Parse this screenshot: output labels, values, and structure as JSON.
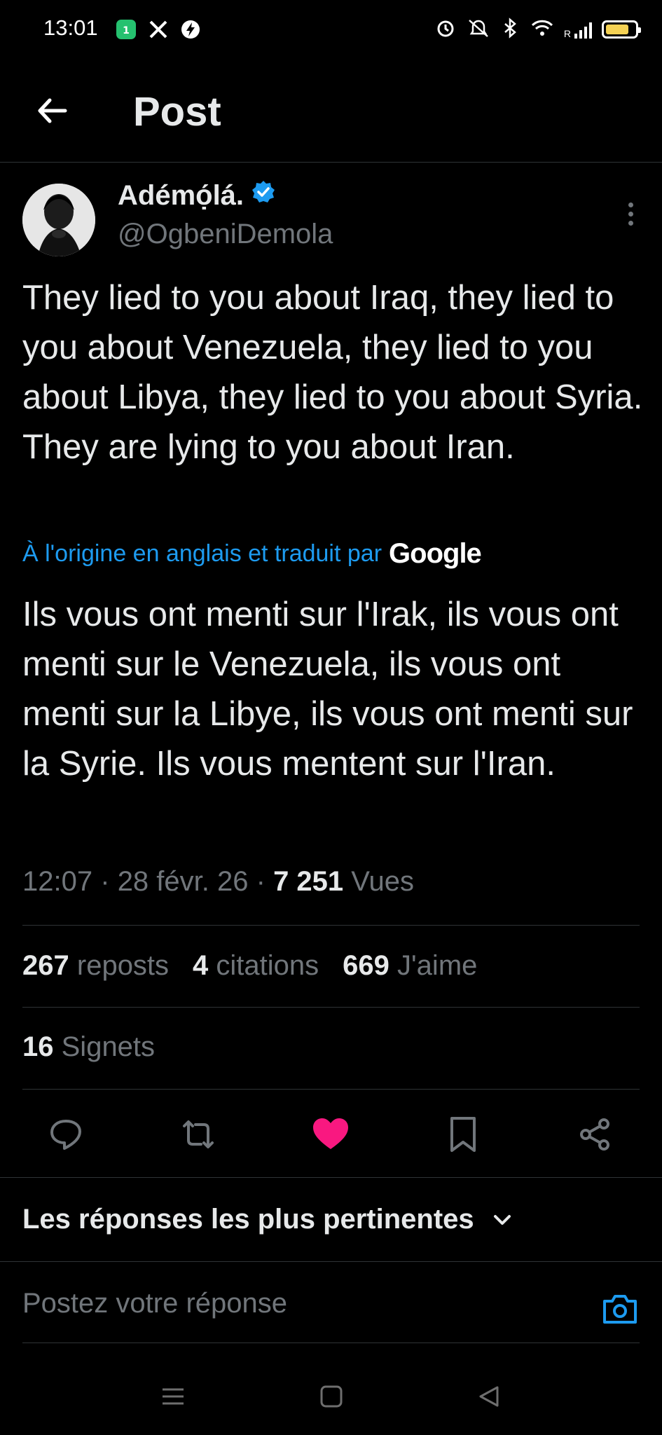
{
  "status_bar": {
    "time": "13:01",
    "icons": [
      "app-badge-icon",
      "x-logo-icon",
      "bolt-icon",
      "alarm-icon",
      "mute-icon",
      "bluetooth-icon",
      "wifi-icon",
      "signal-icon",
      "battery-icon"
    ],
    "signal_label": "R",
    "battery_level": 0.8
  },
  "header": {
    "title": "Post",
    "back_icon": "arrow-left-icon"
  },
  "post": {
    "author_name": "Adémọ́lá.",
    "verified": true,
    "handle": "@OgbeniDemola",
    "text": "They lied to you about Iraq, they lied to you about Venezuela, they lied to you about Libya, they lied to you about Syria. They are lying to you about Iran.",
    "translation_label": "À l'origine en anglais et traduit par",
    "translation_provider": "Google",
    "translated_text": "Ils vous ont menti sur l'Irak, ils vous ont menti sur le Venezuela, ils vous ont menti sur la Libye, ils vous ont menti sur la Syrie. Ils vous mentent sur l'Iran.",
    "time": "12:07",
    "date": "28 févr. 26",
    "views_count": "7 251",
    "views_label": "Vues"
  },
  "stats": {
    "reposts_count": "267",
    "reposts_label": "reposts",
    "quotes_count": "4",
    "quotes_label": "citations",
    "likes_count": "669",
    "likes_label": "J'aime",
    "bookmarks_count": "16",
    "bookmarks_label": "Signets"
  },
  "actions": [
    "reply-icon",
    "repost-icon",
    "like-icon",
    "bookmark-icon",
    "share-icon"
  ],
  "colors": {
    "accent": "#1d9bf0",
    "like": "#f91880",
    "muted": "#71767b",
    "text": "#e7e9ea",
    "battery": "#f5d254",
    "app_badge": "#25c16f"
  },
  "replies": {
    "sort_label": "Les réponses les plus pertinentes",
    "input_placeholder": "Postez votre réponse"
  }
}
